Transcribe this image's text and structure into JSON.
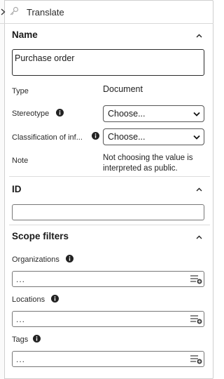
{
  "header": {
    "title": "Translate",
    "chevron_icon": "chevron-right-icon",
    "key_icon": "key-icon"
  },
  "name_section": {
    "title": "Name",
    "name_value": "Purchase order",
    "type_label": "Type",
    "type_value": "Document",
    "stereotype_label": "Stereotype",
    "stereotype_selected": "Choose...",
    "classification_label": "Classification of inf...",
    "classification_selected": "Choose...",
    "note_label": "Note",
    "note_value": "Not choosing the value is interpreted as public."
  },
  "id_section": {
    "title": "ID",
    "id_value": ""
  },
  "scope_section": {
    "title": "Scope filters",
    "organizations_label": "Organizations",
    "organizations_placeholder": "...",
    "locations_label": "Locations",
    "locations_placeholder": "...",
    "tags_label": "Tags",
    "tags_placeholder": "..."
  },
  "colors": {
    "border": "#cfcfcf",
    "text": "#1f1f1f",
    "divider": "#dcdcdc"
  }
}
